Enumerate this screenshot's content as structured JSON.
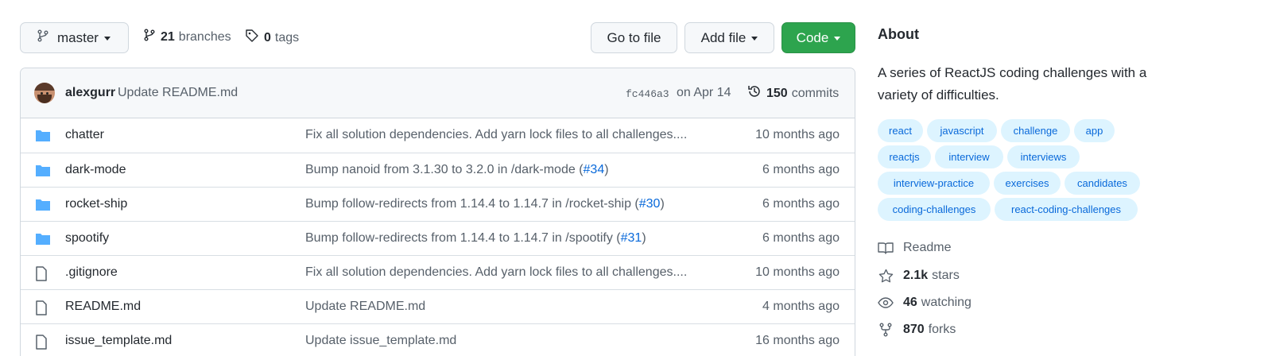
{
  "toolbar": {
    "branch_label": "master",
    "branches_count": "21",
    "branches_label": "branches",
    "tags_count": "0",
    "tags_label": "tags",
    "goto_file": "Go to file",
    "add_file": "Add file",
    "code": "Code"
  },
  "commit": {
    "author": "alexgurr",
    "message": "Update README.md",
    "sha": "fc446a3",
    "date": "on Apr 14",
    "count": "150",
    "count_label": "commits"
  },
  "files": [
    {
      "type": "folder",
      "name": "chatter",
      "message": "Fix all solution dependencies. Add yarn lock files to all challenges....",
      "pr": "",
      "pr_suffix": "",
      "age": "10 months ago"
    },
    {
      "type": "folder",
      "name": "dark-mode",
      "message": "Bump nanoid from 3.1.30 to 3.2.0 in /dark-mode (",
      "pr": "#34",
      "pr_suffix": ")",
      "age": "6 months ago"
    },
    {
      "type": "folder",
      "name": "rocket-ship",
      "message": "Bump follow-redirects from 1.14.4 to 1.14.7 in /rocket-ship (",
      "pr": "#30",
      "pr_suffix": ")",
      "age": "6 months ago"
    },
    {
      "type": "folder",
      "name": "spootify",
      "message": "Bump follow-redirects from 1.14.4 to 1.14.7 in /spootify (",
      "pr": "#31",
      "pr_suffix": ")",
      "age": "6 months ago"
    },
    {
      "type": "file",
      "name": ".gitignore",
      "message": "Fix all solution dependencies. Add yarn lock files to all challenges....",
      "pr": "",
      "pr_suffix": "",
      "age": "10 months ago"
    },
    {
      "type": "file",
      "name": "README.md",
      "message": "Update README.md",
      "pr": "",
      "pr_suffix": "",
      "age": "4 months ago"
    },
    {
      "type": "file",
      "name": "issue_template.md",
      "message": "Update issue_template.md",
      "pr": "",
      "pr_suffix": "",
      "age": "16 months ago"
    }
  ],
  "about": {
    "title": "About",
    "description": "A series of ReactJS coding challenges with a variety of difficulties.",
    "topics": [
      "react",
      "javascript",
      "challenge",
      "app",
      "reactjs",
      "interview",
      "interviews",
      "interview-practice",
      "exercises",
      "candidates",
      "coding-challenges",
      "react-coding-challenges"
    ],
    "readme": "Readme",
    "stars_count": "2.1k",
    "stars_label": "stars",
    "watching_count": "46",
    "watching_label": "watching",
    "forks_count": "870",
    "forks_label": "forks"
  },
  "colors": {
    "accent": "#0969da",
    "code_button": "#2da44e",
    "folder_icon": "#54aeff",
    "topic_bg": "#ddf4ff"
  }
}
